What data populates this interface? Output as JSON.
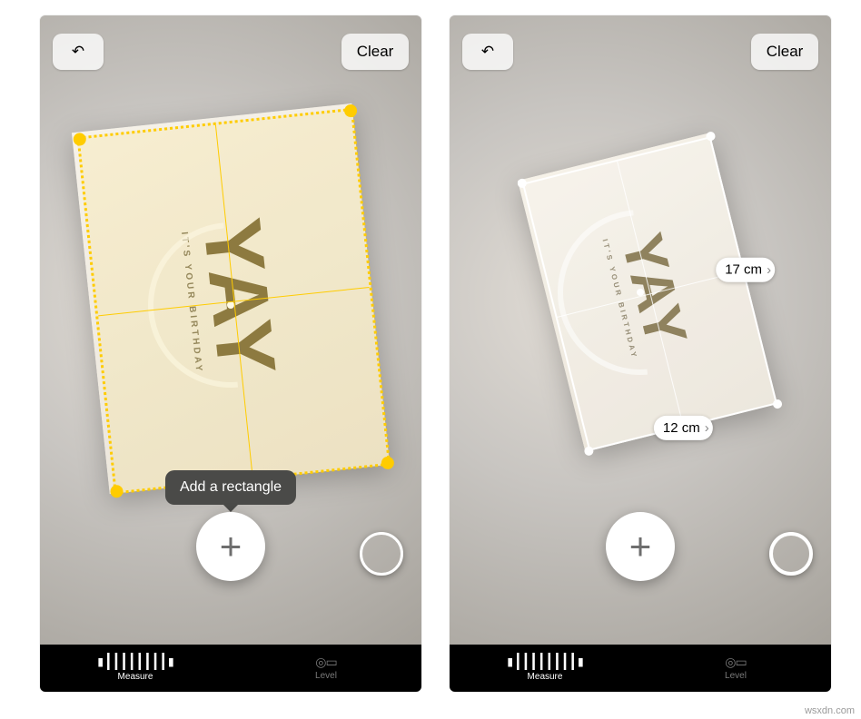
{
  "buttons": {
    "undo_icon": "↶",
    "clear_label": "Clear",
    "add_glyph": "+"
  },
  "tooltip": {
    "add_rectangle": "Add a rectangle"
  },
  "tabs": {
    "measure": {
      "label": "Measure",
      "icon": "▮┃┃┃┃┃┃┃┃▮"
    },
    "level": {
      "label": "Level",
      "icon": "◎▭"
    }
  },
  "measurements": {
    "width_label": "12 cm",
    "height_label": "17 cm",
    "width_cm": 12,
    "height_cm": 17,
    "unit": "cm"
  },
  "card_text": {
    "headline": "YAY",
    "subline": "IT'S YOUR BIRTHDAY"
  },
  "watermark": "wsxdn.com"
}
